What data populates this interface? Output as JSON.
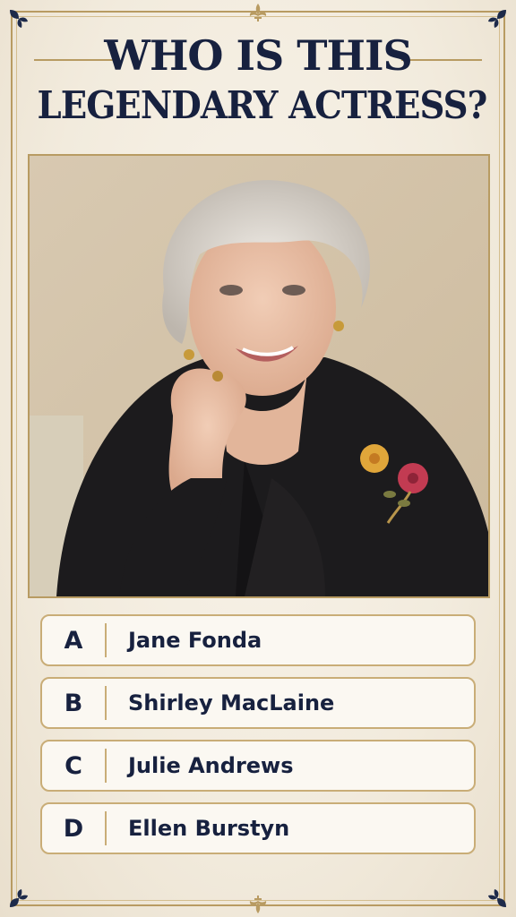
{
  "title": {
    "line1": "WHO IS THIS",
    "line2": "LEGENDARY ACTRESS?"
  },
  "photo": {
    "subject": "portrait-photo"
  },
  "answers": [
    {
      "letter": "A",
      "text": "Jane Fonda"
    },
    {
      "letter": "B",
      "text": "Shirley MacLaine"
    },
    {
      "letter": "C",
      "text": "Julie Andrews"
    },
    {
      "letter": "D",
      "text": "Ellen Burstyn"
    }
  ],
  "colors": {
    "navy": "#17213f",
    "gold": "#b89b62",
    "background": "#f2ebdd"
  }
}
